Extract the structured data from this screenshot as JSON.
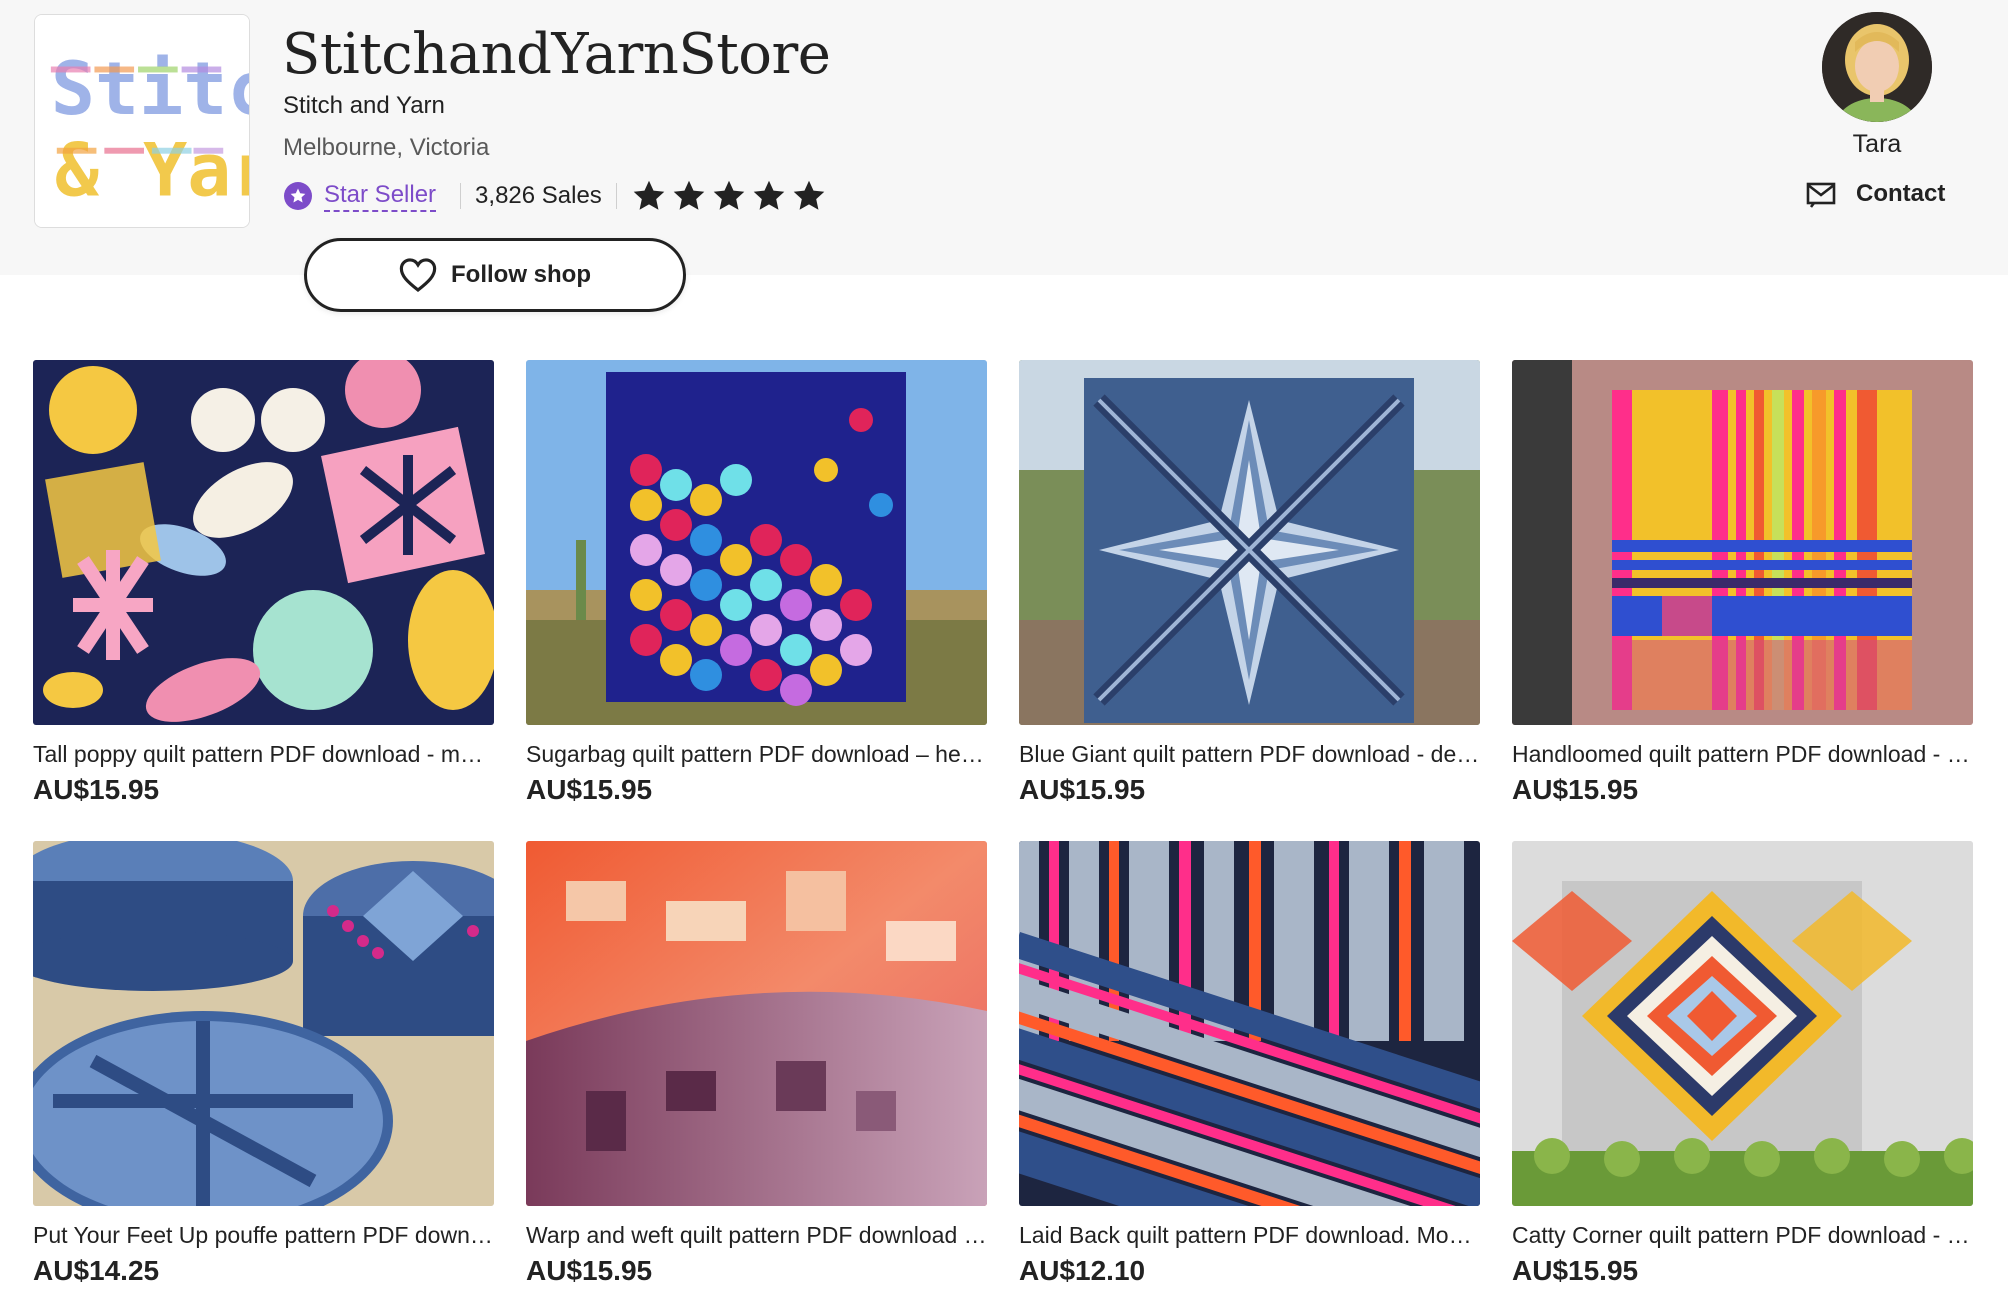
{
  "shop": {
    "name": "StitchandYarnStore",
    "subtitle": "Stitch and Yarn",
    "location": "Melbourne, Victoria",
    "badge_label": "Star Seller",
    "sales": "3,826 Sales",
    "rating_stars": 5,
    "follow_label": "Follow shop",
    "logo_lines": [
      "Stitch",
      "& Yarn"
    ]
  },
  "owner": {
    "name": "Tara",
    "contact_label": "Contact"
  },
  "colors": {
    "accent_purple": "#7d4cc9",
    "text": "#222222",
    "header_bg": "#f7f7f7"
  },
  "listings": [
    {
      "title": "Tall poppy quilt pattern PDF download - modern quilt pattern",
      "price": "AU$15.95"
    },
    {
      "title": "Sugarbag quilt pattern PDF download – hexagon quilt pattern",
      "price": "AU$15.95"
    },
    {
      "title": "Blue Giant quilt pattern PDF download - denim star quilt",
      "price": "AU$15.95"
    },
    {
      "title": "Handloomed quilt pattern PDF download - modern stripe quilt",
      "price": "AU$15.95"
    },
    {
      "title": "Put Your Feet Up pouffe pattern PDF download - denim pouffe",
      "price": "AU$14.25"
    },
    {
      "title": "Warp and weft quilt pattern PDF download - modern quilt",
      "price": "AU$15.95"
    },
    {
      "title": "Laid Back quilt pattern PDF download. Modern stripe quilt",
      "price": "AU$12.10"
    },
    {
      "title": "Catty Corner quilt pattern PDF download - diamond quilt",
      "price": "AU$15.95"
    }
  ]
}
